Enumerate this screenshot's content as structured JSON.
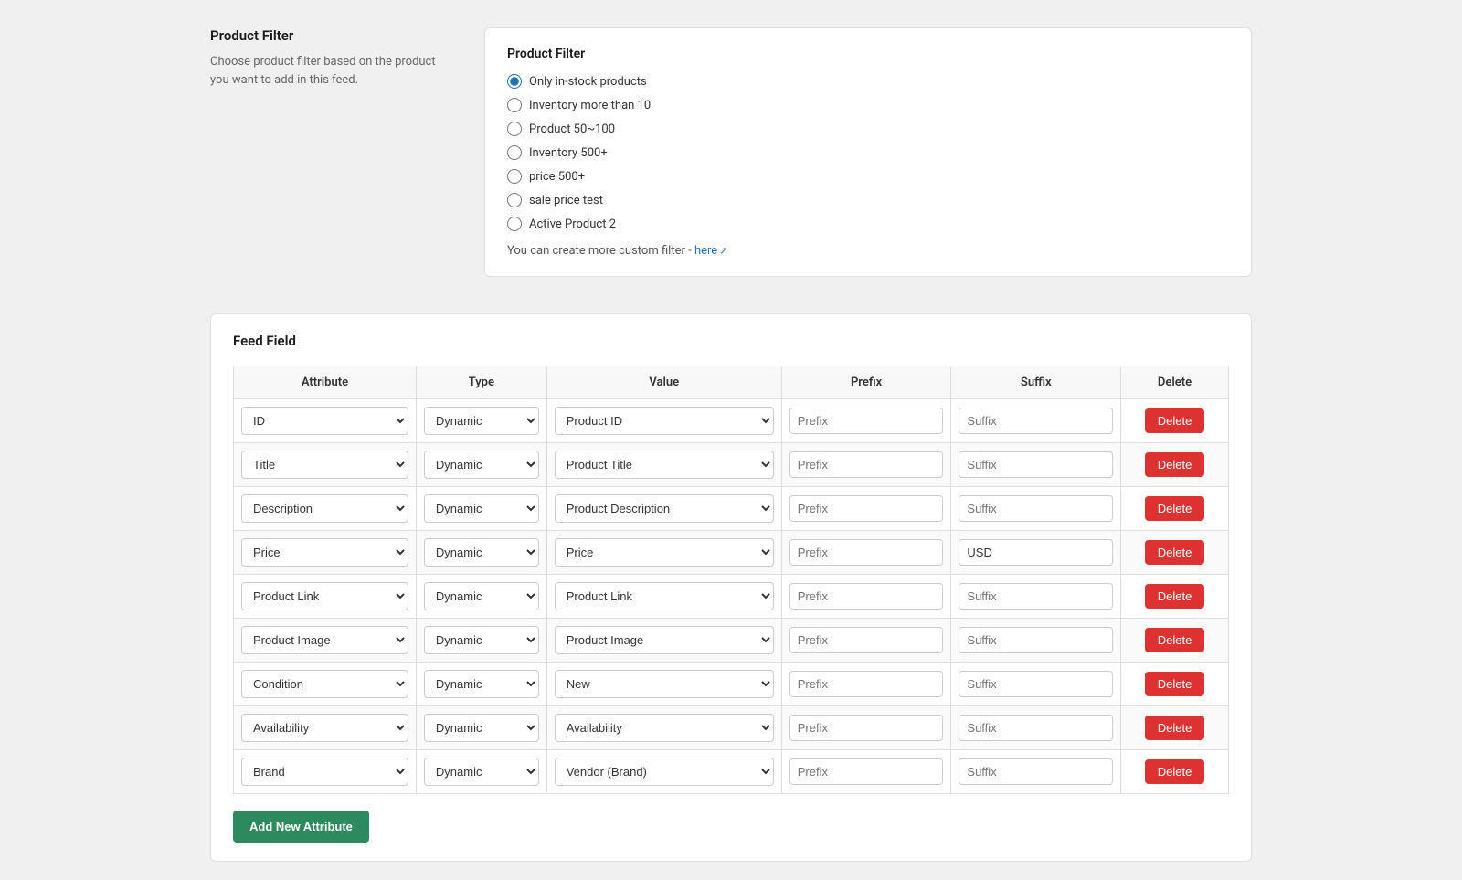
{
  "productFilter": {
    "sectionTitle": "Product Filter",
    "description": "Choose product filter based on the product you want to add in this feed.",
    "cardTitle": "Product Filter",
    "options": [
      {
        "id": "filter-instock",
        "label": "Only in-stock products",
        "checked": true
      },
      {
        "id": "filter-inv10",
        "label": "Inventory more than 10",
        "checked": false
      },
      {
        "id": "filter-price50",
        "label": "Product 50~100",
        "checked": false
      },
      {
        "id": "filter-inv500",
        "label": "Inventory 500+",
        "checked": false
      },
      {
        "id": "filter-price500",
        "label": "price 500+",
        "checked": false
      },
      {
        "id": "filter-saleprice",
        "label": "sale price test",
        "checked": false
      },
      {
        "id": "filter-active2",
        "label": "Active Product 2",
        "checked": false
      }
    ],
    "customFilterNote": "You can create more custom filter -",
    "customFilterLinkText": "here",
    "customFilterLinkUrl": "#"
  },
  "feedField": {
    "sectionTitle": "Feed Field",
    "table": {
      "headers": [
        "Attribute",
        "Type",
        "Value",
        "Prefix",
        "Suffix",
        "Delete"
      ],
      "rows": [
        {
          "attribute": "ID",
          "type": "Dynamic",
          "value": "Product ID",
          "prefix": "",
          "prefixPlaceholder": "Prefix",
          "suffix": "",
          "suffixPlaceholder": "Suffix"
        },
        {
          "attribute": "Title",
          "type": "Dynamic",
          "value": "Product Title",
          "prefix": "",
          "prefixPlaceholder": "Prefix",
          "suffix": "",
          "suffixPlaceholder": "Suffix"
        },
        {
          "attribute": "Description",
          "type": "Dynamic",
          "value": "Product Description",
          "prefix": "",
          "prefixPlaceholder": "Prefix",
          "suffix": "",
          "suffixPlaceholder": "Suffix"
        },
        {
          "attribute": "Price",
          "type": "Dynamic",
          "value": "Price",
          "prefix": "",
          "prefixPlaceholder": "Prefix",
          "suffix": "USD",
          "suffixPlaceholder": "Suffix"
        },
        {
          "attribute": "Product Link",
          "type": "Dynamic",
          "value": "Product Link",
          "prefix": "",
          "prefixPlaceholder": "Prefix",
          "suffix": "",
          "suffixPlaceholder": "Suffix"
        },
        {
          "attribute": "Product Image",
          "type": "Dynamic",
          "value": "Product Image",
          "prefix": "",
          "prefixPlaceholder": "Prefix",
          "suffix": "",
          "suffixPlaceholder": "Suffix"
        },
        {
          "attribute": "Condition",
          "type": "Dynamic",
          "value": "New",
          "prefix": "",
          "prefixPlaceholder": "Prefix",
          "suffix": "",
          "suffixPlaceholder": "Suffix"
        },
        {
          "attribute": "Availability",
          "type": "Dynamic",
          "value": "Availability",
          "prefix": "",
          "prefixPlaceholder": "Prefix",
          "suffix": "",
          "suffixPlaceholder": "Suffix"
        },
        {
          "attribute": "Brand",
          "type": "Dynamic",
          "value": "Vendor (Brand)",
          "prefix": "",
          "prefixPlaceholder": "Prefix",
          "suffix": "",
          "suffixPlaceholder": "Suffix"
        }
      ]
    },
    "addButtonLabel": "Add New Attribute",
    "deleteButtonLabel": "Delete"
  }
}
